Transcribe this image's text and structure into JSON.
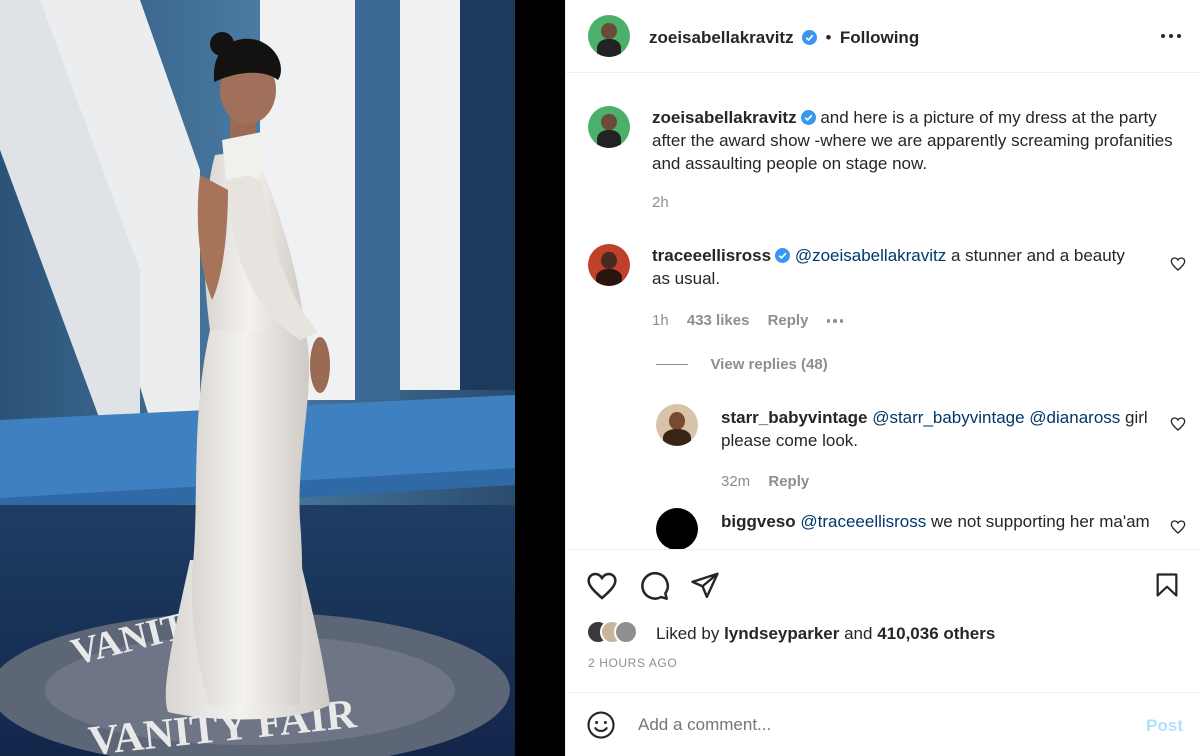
{
  "post": {
    "author": "zoeisabellakravitz",
    "separator": "•",
    "follow_status": "Following",
    "caption": "and here is a picture of my dress at the party after the award show -where we are apparently screaming profanities and assaulting people on stage now.",
    "caption_time": "2h",
    "photo_signage": {
      "ring_top": "VANITY FAIR",
      "ring_bottom": "VANITY FAIR",
      "letter": "V"
    }
  },
  "comments": [
    {
      "username": "traceeellisross",
      "verified": true,
      "mention": "@zoeisabellakravitz",
      "text": "a stunner and a beauty as usual.",
      "time": "1h",
      "likes": "433 likes",
      "reply": "Reply",
      "view_replies": "View replies (48)"
    }
  ],
  "replies": [
    {
      "username": "starr_babyvintage",
      "mention": "@starr_babyvintage @dianaross",
      "text": "girl please come look.",
      "time": "32m",
      "reply": "Reply"
    },
    {
      "username": "biggveso",
      "mention": "@traceeellisross",
      "text": "we not supporting her ma'am"
    }
  ],
  "likes": {
    "prefix": "Liked by",
    "user": "lyndseyparker",
    "and": "and",
    "count": "410,036 others"
  },
  "timestamp": "2 HOURS AGO",
  "add_comment": {
    "placeholder": "Add a comment...",
    "post": "Post"
  },
  "colors": {
    "mention": "#00376b",
    "verified": "#3897f0",
    "post_button_disabled": "#b2dffc",
    "zoe_avatar_bg": "#4caf6a",
    "photo_backdrop": "#27496b"
  },
  "icons": [
    "heart-icon",
    "comment-icon",
    "share-icon",
    "bookmark-icon",
    "emoji-icon",
    "more-options-icon",
    "verified-badge-icon"
  ]
}
